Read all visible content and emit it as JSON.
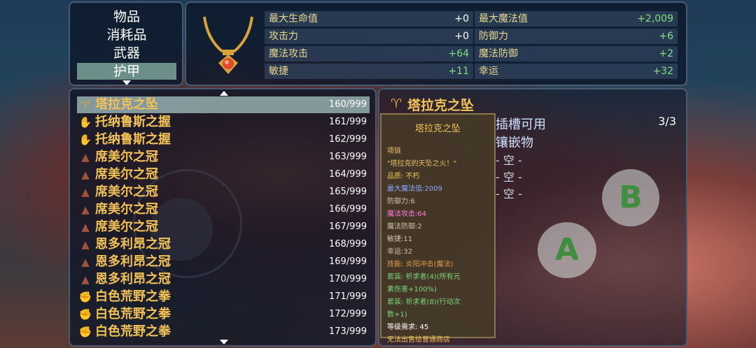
{
  "categories": [
    {
      "label": "物品"
    },
    {
      "label": "消耗品"
    },
    {
      "label": "武器"
    },
    {
      "label": "护甲",
      "selected": true
    }
  ],
  "stats": [
    {
      "label": "最大生命值",
      "value": "+0"
    },
    {
      "label": "最大魔法值",
      "value": "+2,009"
    },
    {
      "label": "攻击力",
      "value": "+0"
    },
    {
      "label": "防御力",
      "value": "+6"
    },
    {
      "label": "魔法攻击",
      "value": "+64"
    },
    {
      "label": "魔法防御",
      "value": "+2"
    },
    {
      "label": "敏捷",
      "value": "+11"
    },
    {
      "label": "幸运",
      "value": "+32"
    }
  ],
  "items": [
    {
      "icon": "necklace-icon",
      "glyph": "♈",
      "name": "塔拉克之坠",
      "qty": "160/999",
      "selected": true
    },
    {
      "icon": "gauntlet-icon",
      "glyph": "✋",
      "name": "托纳鲁斯之握",
      "qty": "161/999"
    },
    {
      "icon": "gauntlet-icon",
      "glyph": "✋",
      "name": "托纳鲁斯之握",
      "qty": "162/999"
    },
    {
      "icon": "crown-icon",
      "glyph": "▲",
      "name": "席美尔之冠",
      "qty": "163/999"
    },
    {
      "icon": "crown-icon",
      "glyph": "▲",
      "name": "席美尔之冠",
      "qty": "164/999"
    },
    {
      "icon": "crown-icon",
      "glyph": "▲",
      "name": "席美尔之冠",
      "qty": "165/999"
    },
    {
      "icon": "crown-icon",
      "glyph": "▲",
      "name": "席美尔之冠",
      "qty": "166/999"
    },
    {
      "icon": "crown-icon",
      "glyph": "▲",
      "name": "席美尔之冠",
      "qty": "167/999"
    },
    {
      "icon": "crown-icon",
      "glyph": "▲",
      "name": "恩多利昂之冠",
      "qty": "168/999"
    },
    {
      "icon": "crown-icon",
      "glyph": "▲",
      "name": "恩多利昂之冠",
      "qty": "169/999"
    },
    {
      "icon": "crown-icon",
      "glyph": "▲",
      "name": "恩多利昂之冠",
      "qty": "170/999"
    },
    {
      "icon": "fist-icon",
      "glyph": "✊",
      "name": "白色荒野之拳",
      "qty": "171/999"
    },
    {
      "icon": "fist-icon",
      "glyph": "✊",
      "name": "白色荒野之拳",
      "qty": "172/999"
    },
    {
      "icon": "fist-icon",
      "glyph": "✊",
      "name": "白色荒野之拳",
      "qty": "173/999"
    }
  ],
  "detail": {
    "title": "塔拉克之坠",
    "socket_label": "插槽可用",
    "socket_value": "3/3",
    "embed_label": "镶嵌物",
    "empty_slots": [
      "- 空 -",
      "- 空 -",
      "- 空 -"
    ]
  },
  "tooltip": {
    "title": "塔拉克之坠",
    "lines": [
      {
        "text": "项链",
        "color": "#e8c070"
      },
      {
        "text": "\"塔拉克的天坠之火！\"",
        "color": "#e8c070"
      },
      {
        "text": "品质: 不朽",
        "color": "#f3c257"
      },
      {
        "text": "最大魔法值:2009",
        "color": "#8aa8ff"
      },
      {
        "text": "防御力:6",
        "color": "#cfc3a8"
      },
      {
        "text": "魔法攻击:64",
        "color": "#ff7adf"
      },
      {
        "text": "魔法防御:2",
        "color": "#cfc3a8"
      },
      {
        "text": "敏捷:11",
        "color": "#cfc3a8"
      },
      {
        "text": "幸运:32",
        "color": "#cfc3a8"
      },
      {
        "text": "技能: 炎阳冲击(魔法)",
        "color": "#e09b4e"
      },
      {
        "text": "套装: 祈求者(4)(所有元",
        "color": "#7bd67b"
      },
      {
        "text": "素伤害+100%)",
        "color": "#7bd67b"
      },
      {
        "text": "套装: 祈求者(8)(行动次",
        "color": "#7bd67b"
      },
      {
        "text": "数+1)",
        "color": "#7bd67b"
      },
      {
        "text": "等级需求: 45",
        "color": "#ffffff"
      },
      {
        "text": "无法出售给普通商店",
        "color": "#f3c257"
      }
    ]
  },
  "buttons": {
    "a": "A",
    "b": "B"
  }
}
